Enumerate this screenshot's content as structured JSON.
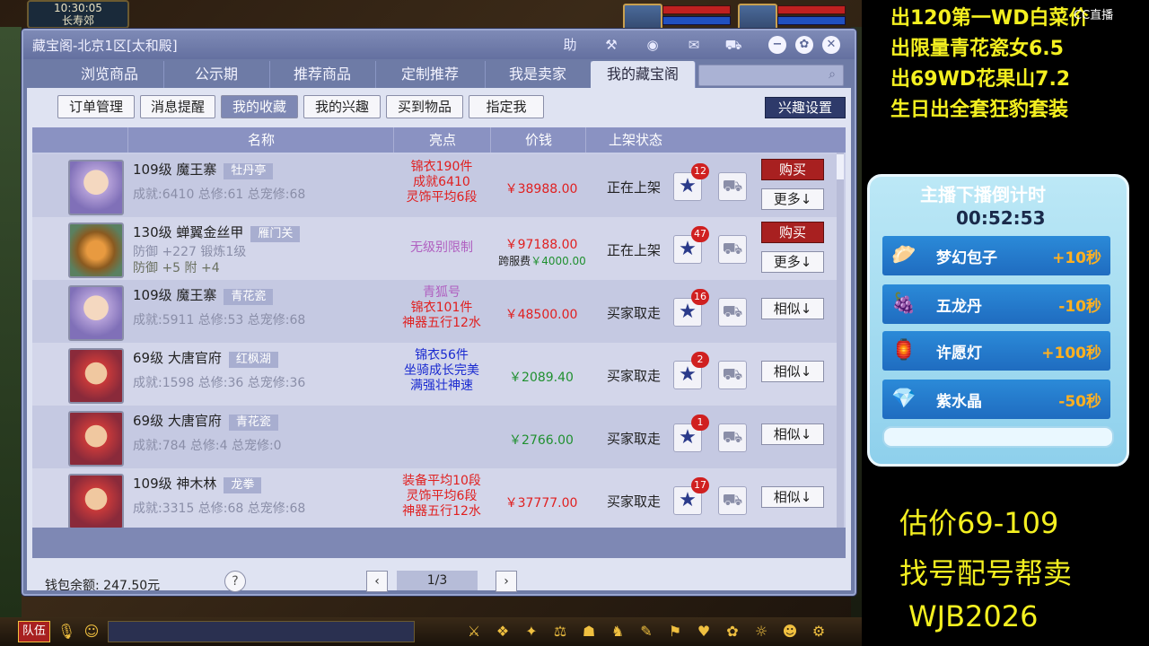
{
  "game": {
    "clock": "10:30:05",
    "location": "长寿郊"
  },
  "window": {
    "title": "藏宝阁-北京1区[太和殿]",
    "toolbar": {
      "help": "助"
    },
    "tabs": [
      "浏览商品",
      "公示期",
      "推荐商品",
      "定制推荐",
      "我是卖家",
      "我的藏宝阁"
    ],
    "active_tab_index": 5,
    "search": {
      "placeholder": ""
    },
    "subtabs": [
      "订单管理",
      "消息提醒",
      "我的收藏",
      "我的兴趣",
      "买到物品",
      "指定我"
    ],
    "active_subtab_index": 2,
    "interest_settings": "兴趣设置",
    "columns": [
      "名称",
      "亮点",
      "价钱",
      "上架状态"
    ],
    "rows": [
      {
        "level_name": "109级 魔王寨",
        "server": "牡丹亭",
        "stats": "成就:6410 总修:61 总宠修:68",
        "highlights": [
          "锦衣190件",
          "成就6410",
          "灵饰平均6段"
        ],
        "hl_color": "red",
        "price": "￥38988.00",
        "status": "正在上架",
        "fav_count": "12",
        "primary_btn": "购买",
        "secondary_btn": "更多↓"
      },
      {
        "level_name": "130级 蝉翼金丝甲",
        "server": "雁门关",
        "stats1": "防御 +227 锻炼1级",
        "stats2": "防御 +5 附 +4",
        "highlights": [
          "无级别限制"
        ],
        "hl_color": "purple",
        "price": "￥97188.00",
        "cross_fee_label": "跨服费",
        "cross_fee": "￥4000.00",
        "status": "正在上架",
        "fav_count": "47",
        "primary_btn": "购买",
        "secondary_btn": "更多↓"
      },
      {
        "level_name": "109级 魔王寨",
        "server": "青花瓷",
        "stats": "成就:5911 总修:53 总宠修:68",
        "highlights": [
          "青狐号",
          "锦衣101件",
          "神器五行12水"
        ],
        "hl_color": "red",
        "price": "￥48500.00",
        "status": "买家取走",
        "fav_count": "16",
        "secondary_btn": "相似↓"
      },
      {
        "level_name": "69级 大唐官府",
        "server": "红枫湖",
        "stats": "成就:1598 总修:36 总宠修:36",
        "highlights": [
          "锦衣56件",
          "坐骑成长完美",
          "满强壮神速"
        ],
        "hl_color": "blue",
        "price": "￥2089.40",
        "status": "买家取走",
        "fav_count": "2",
        "secondary_btn": "相似↓"
      },
      {
        "level_name": "69级 大唐官府",
        "server": "青花瓷",
        "stats": "成就:784 总修:4 总宠修:0",
        "highlights": [],
        "price": "￥2766.00",
        "status": "买家取走",
        "fav_count": "1",
        "secondary_btn": "相似↓"
      },
      {
        "level_name": "109级 神木林",
        "server": "龙拳",
        "stats": "成就:3315 总修:68 总宠修:68",
        "highlights": [
          "装备平均10段",
          "灵饰平均6段",
          "神器五行12水"
        ],
        "hl_color": "red",
        "price": "￥37777.00",
        "status": "买家取走",
        "fav_count": "17",
        "secondary_btn": "相似↓"
      }
    ],
    "wallet": "钱包余额: 247.50元",
    "page": "1/3"
  },
  "bottom": {
    "team": "队伍"
  },
  "stream": {
    "promos": [
      "出120第一WD白菜价",
      "出限量青花瓷女6.5",
      "出69WD花果山7.2",
      "生日出全套狂豹套装"
    ],
    "cc_logo": "CC直播",
    "countdown_title": "主播下播倒计时",
    "countdown_time": "00:52:53",
    "gifts": [
      {
        "name": "梦幻包子",
        "effect": "+10秒",
        "icon": "bun-icon"
      },
      {
        "name": "五龙丹",
        "effect": "-10秒",
        "icon": "pill-icon"
      },
      {
        "name": "许愿灯",
        "effect": "+100秒",
        "icon": "lantern-icon"
      },
      {
        "name": "紫水晶",
        "effect": "-50秒",
        "icon": "crystal-icon"
      }
    ],
    "notes": [
      "估价69-109",
      "找号配号帮卖",
      "WJB2026"
    ]
  }
}
